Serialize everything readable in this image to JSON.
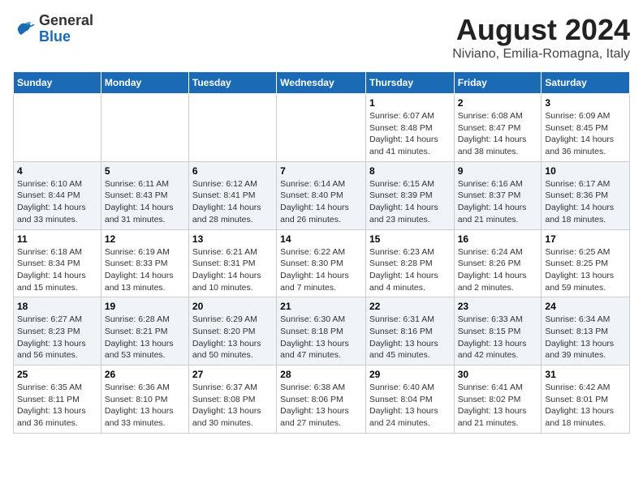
{
  "header": {
    "logo_general": "General",
    "logo_blue": "Blue",
    "month_title": "August 2024",
    "location": "Niviano, Emilia-Romagna, Italy"
  },
  "days_of_week": [
    "Sunday",
    "Monday",
    "Tuesday",
    "Wednesday",
    "Thursday",
    "Friday",
    "Saturday"
  ],
  "weeks": [
    [
      {
        "day": "",
        "info": ""
      },
      {
        "day": "",
        "info": ""
      },
      {
        "day": "",
        "info": ""
      },
      {
        "day": "",
        "info": ""
      },
      {
        "day": "1",
        "info": "Sunrise: 6:07 AM\nSunset: 8:48 PM\nDaylight: 14 hours and 41 minutes."
      },
      {
        "day": "2",
        "info": "Sunrise: 6:08 AM\nSunset: 8:47 PM\nDaylight: 14 hours and 38 minutes."
      },
      {
        "day": "3",
        "info": "Sunrise: 6:09 AM\nSunset: 8:45 PM\nDaylight: 14 hours and 36 minutes."
      }
    ],
    [
      {
        "day": "4",
        "info": "Sunrise: 6:10 AM\nSunset: 8:44 PM\nDaylight: 14 hours and 33 minutes."
      },
      {
        "day": "5",
        "info": "Sunrise: 6:11 AM\nSunset: 8:43 PM\nDaylight: 14 hours and 31 minutes."
      },
      {
        "day": "6",
        "info": "Sunrise: 6:12 AM\nSunset: 8:41 PM\nDaylight: 14 hours and 28 minutes."
      },
      {
        "day": "7",
        "info": "Sunrise: 6:14 AM\nSunset: 8:40 PM\nDaylight: 14 hours and 26 minutes."
      },
      {
        "day": "8",
        "info": "Sunrise: 6:15 AM\nSunset: 8:39 PM\nDaylight: 14 hours and 23 minutes."
      },
      {
        "day": "9",
        "info": "Sunrise: 6:16 AM\nSunset: 8:37 PM\nDaylight: 14 hours and 21 minutes."
      },
      {
        "day": "10",
        "info": "Sunrise: 6:17 AM\nSunset: 8:36 PM\nDaylight: 14 hours and 18 minutes."
      }
    ],
    [
      {
        "day": "11",
        "info": "Sunrise: 6:18 AM\nSunset: 8:34 PM\nDaylight: 14 hours and 15 minutes."
      },
      {
        "day": "12",
        "info": "Sunrise: 6:19 AM\nSunset: 8:33 PM\nDaylight: 14 hours and 13 minutes."
      },
      {
        "day": "13",
        "info": "Sunrise: 6:21 AM\nSunset: 8:31 PM\nDaylight: 14 hours and 10 minutes."
      },
      {
        "day": "14",
        "info": "Sunrise: 6:22 AM\nSunset: 8:30 PM\nDaylight: 14 hours and 7 minutes."
      },
      {
        "day": "15",
        "info": "Sunrise: 6:23 AM\nSunset: 8:28 PM\nDaylight: 14 hours and 4 minutes."
      },
      {
        "day": "16",
        "info": "Sunrise: 6:24 AM\nSunset: 8:26 PM\nDaylight: 14 hours and 2 minutes."
      },
      {
        "day": "17",
        "info": "Sunrise: 6:25 AM\nSunset: 8:25 PM\nDaylight: 13 hours and 59 minutes."
      }
    ],
    [
      {
        "day": "18",
        "info": "Sunrise: 6:27 AM\nSunset: 8:23 PM\nDaylight: 13 hours and 56 minutes."
      },
      {
        "day": "19",
        "info": "Sunrise: 6:28 AM\nSunset: 8:21 PM\nDaylight: 13 hours and 53 minutes."
      },
      {
        "day": "20",
        "info": "Sunrise: 6:29 AM\nSunset: 8:20 PM\nDaylight: 13 hours and 50 minutes."
      },
      {
        "day": "21",
        "info": "Sunrise: 6:30 AM\nSunset: 8:18 PM\nDaylight: 13 hours and 47 minutes."
      },
      {
        "day": "22",
        "info": "Sunrise: 6:31 AM\nSunset: 8:16 PM\nDaylight: 13 hours and 45 minutes."
      },
      {
        "day": "23",
        "info": "Sunrise: 6:33 AM\nSunset: 8:15 PM\nDaylight: 13 hours and 42 minutes."
      },
      {
        "day": "24",
        "info": "Sunrise: 6:34 AM\nSunset: 8:13 PM\nDaylight: 13 hours and 39 minutes."
      }
    ],
    [
      {
        "day": "25",
        "info": "Sunrise: 6:35 AM\nSunset: 8:11 PM\nDaylight: 13 hours and 36 minutes."
      },
      {
        "day": "26",
        "info": "Sunrise: 6:36 AM\nSunset: 8:10 PM\nDaylight: 13 hours and 33 minutes."
      },
      {
        "day": "27",
        "info": "Sunrise: 6:37 AM\nSunset: 8:08 PM\nDaylight: 13 hours and 30 minutes."
      },
      {
        "day": "28",
        "info": "Sunrise: 6:38 AM\nSunset: 8:06 PM\nDaylight: 13 hours and 27 minutes."
      },
      {
        "day": "29",
        "info": "Sunrise: 6:40 AM\nSunset: 8:04 PM\nDaylight: 13 hours and 24 minutes."
      },
      {
        "day": "30",
        "info": "Sunrise: 6:41 AM\nSunset: 8:02 PM\nDaylight: 13 hours and 21 minutes."
      },
      {
        "day": "31",
        "info": "Sunrise: 6:42 AM\nSunset: 8:01 PM\nDaylight: 13 hours and 18 minutes."
      }
    ]
  ]
}
